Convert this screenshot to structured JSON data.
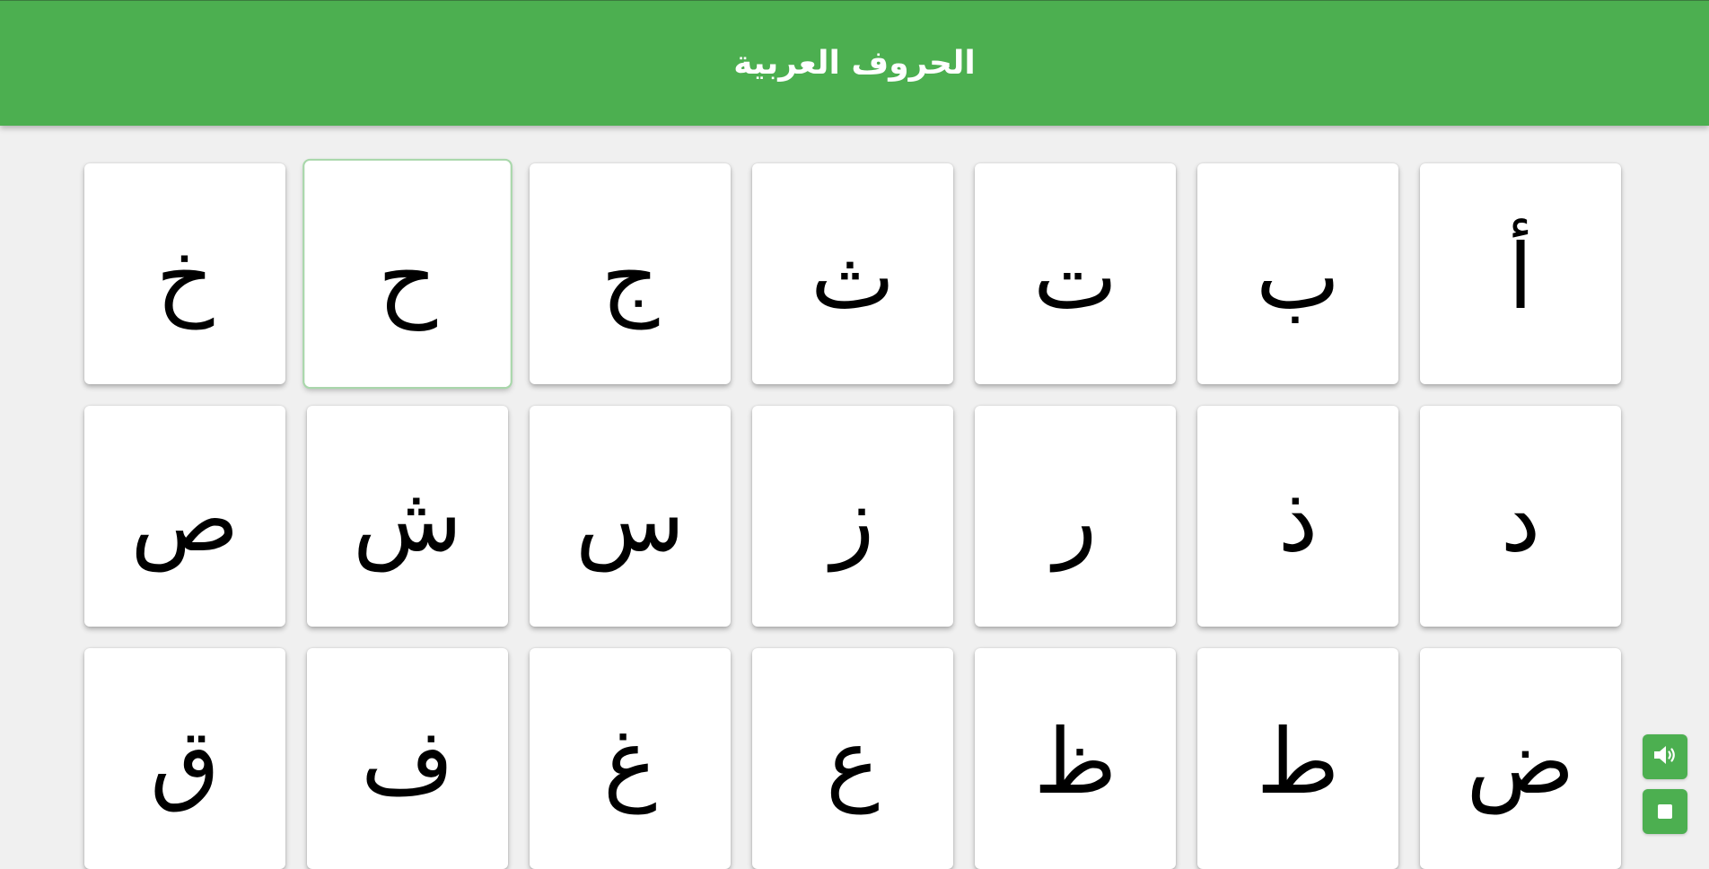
{
  "header": {
    "title": "الحروف العربية"
  },
  "letters": [
    "أ",
    "ب",
    "ت",
    "ث",
    "ج",
    "ح",
    "خ",
    "د",
    "ذ",
    "ر",
    "ز",
    "س",
    "ش",
    "ص",
    "ض",
    "ط",
    "ظ",
    "ع",
    "غ",
    "ف",
    "ق"
  ],
  "controls": {
    "sound_icon": "speaker-volume-icon",
    "stop_icon": "stop-square-icon"
  },
  "colors": {
    "accent": "#4caf50",
    "background": "#f0f0f0",
    "card": "#ffffff"
  }
}
